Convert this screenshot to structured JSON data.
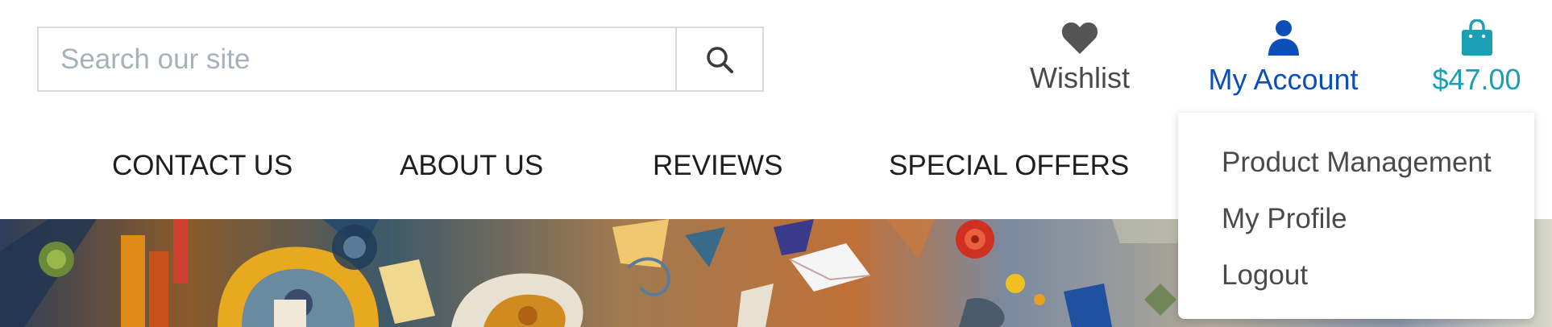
{
  "search": {
    "placeholder": "Search our site",
    "button_icon": "search-icon"
  },
  "header_actions": {
    "wishlist": {
      "label": "Wishlist",
      "icon": "heart-icon",
      "color": "#4a4a4a"
    },
    "account": {
      "label": "My Account",
      "icon": "user-icon",
      "color": "#0d4fb8"
    },
    "cart": {
      "label": "$47.00",
      "icon": "shopping-bag-icon",
      "color": "#1a9fb5"
    }
  },
  "nav": {
    "items": [
      {
        "label": "CONTACT US"
      },
      {
        "label": "ABOUT US"
      },
      {
        "label": "REVIEWS"
      },
      {
        "label": "SPECIAL OFFERS"
      }
    ]
  },
  "account_menu": {
    "items": [
      {
        "label": "Product Management"
      },
      {
        "label": "My Profile"
      },
      {
        "label": "Logout"
      }
    ]
  }
}
